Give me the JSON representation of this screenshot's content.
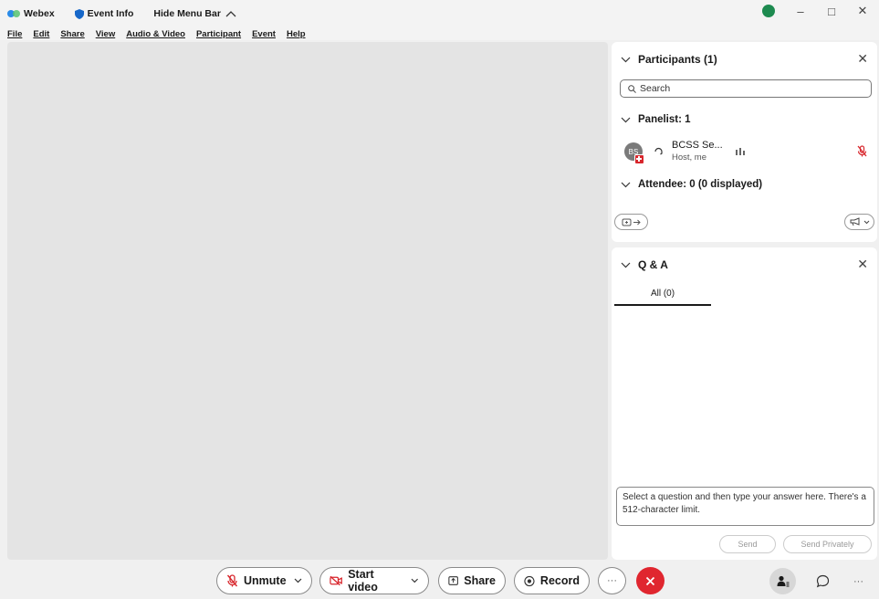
{
  "titlebar": {
    "app_name": "Webex",
    "event_info": "Event Info",
    "hide_menu_bar": "Hide Menu Bar"
  },
  "menubar": {
    "items": [
      "File",
      "Edit",
      "Share",
      "View",
      "Audio & Video",
      "Participant",
      "Event",
      "Help"
    ]
  },
  "participants_panel": {
    "title": "Participants (1)",
    "search_placeholder": "Search",
    "panelist_section": "Panelist: 1",
    "attendee_section": "Attendee: 0 (0 displayed)",
    "participant": {
      "initials": "BS",
      "name": "BCSS Se...",
      "role": "Host, me"
    }
  },
  "qa_panel": {
    "title": "Q & A",
    "tab_all": "All (0)",
    "answer_placeholder": "Select a question and then type your answer here. There's a 512-character limit.",
    "send_label": "Send",
    "send_privately_label": "Send Privately"
  },
  "toolbar": {
    "unmute_label": "Unmute",
    "start_video_label": "Start video",
    "share_label": "Share",
    "record_label": "Record",
    "more_label": "···",
    "ellipsis_label": "···"
  },
  "colors": {
    "leave_red": "#e0262f",
    "stage_gray": "#e4e4e4",
    "mute_red": "#d8262c",
    "status_green": "#1d8a4f"
  }
}
